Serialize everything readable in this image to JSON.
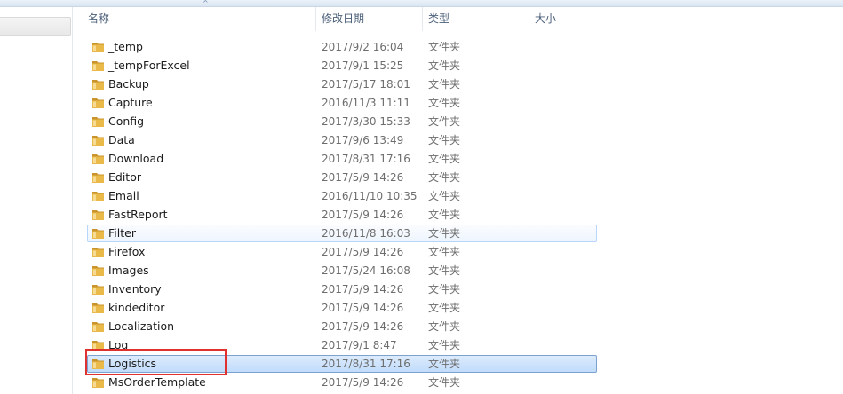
{
  "header": {
    "name": "名称",
    "date": "修改日期",
    "type": "类型",
    "size": "大小",
    "sort_indicator": "^"
  },
  "colors": {
    "folder": "#e9b949",
    "folder_dark": "#c9942b",
    "selection": "#c1dcfc",
    "annotation": "#e03131"
  },
  "rows": [
    {
      "name": "_temp",
      "date": "2017/9/2 16:04",
      "type": "文件夹"
    },
    {
      "name": "_tempForExcel",
      "date": "2017/9/1 15:25",
      "type": "文件夹"
    },
    {
      "name": "Backup",
      "date": "2017/5/17 18:01",
      "type": "文件夹"
    },
    {
      "name": "Capture",
      "date": "2016/11/3 11:11",
      "type": "文件夹"
    },
    {
      "name": "Config",
      "date": "2017/3/30 15:33",
      "type": "文件夹"
    },
    {
      "name": "Data",
      "date": "2017/9/6 13:49",
      "type": "文件夹"
    },
    {
      "name": "Download",
      "date": "2017/8/31 17:16",
      "type": "文件夹"
    },
    {
      "name": "Editor",
      "date": "2017/5/9 14:26",
      "type": "文件夹"
    },
    {
      "name": "Email",
      "date": "2016/11/10 10:35",
      "type": "文件夹"
    },
    {
      "name": "FastReport",
      "date": "2017/5/9 14:26",
      "type": "文件夹"
    },
    {
      "name": "Filter",
      "date": "2016/11/8 16:03",
      "type": "文件夹"
    },
    {
      "name": "Firefox",
      "date": "2017/5/9 14:26",
      "type": "文件夹"
    },
    {
      "name": "Images",
      "date": "2017/5/24 16:08",
      "type": "文件夹"
    },
    {
      "name": "Inventory",
      "date": "2017/5/9 14:26",
      "type": "文件夹"
    },
    {
      "name": "kindeditor",
      "date": "2017/5/9 14:26",
      "type": "文件夹"
    },
    {
      "name": "Localization",
      "date": "2017/5/9 14:26",
      "type": "文件夹"
    },
    {
      "name": "Log",
      "date": "2017/9/1 8:47",
      "type": "文件夹"
    },
    {
      "name": "Logistics",
      "date": "2017/8/31 17:16",
      "type": "文件夹"
    },
    {
      "name": "MsOrderTemplate",
      "date": "2017/5/9 14:26",
      "type": "文件夹"
    }
  ],
  "hover_row": "Filter",
  "selected_row": "Logistics"
}
